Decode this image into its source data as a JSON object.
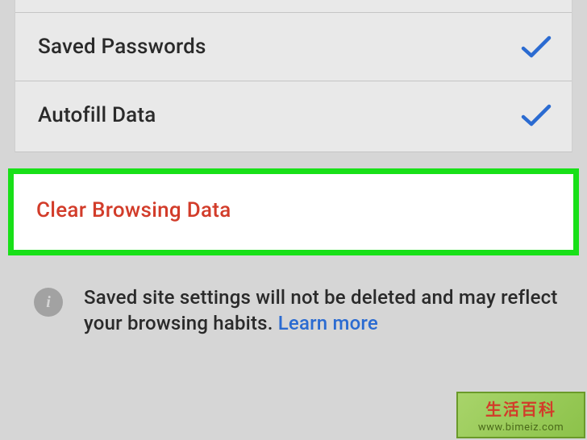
{
  "options": {
    "saved_passwords": {
      "label": "Saved Passwords",
      "checked": true
    },
    "autofill_data": {
      "label": "Autofill Data",
      "checked": true
    }
  },
  "action": {
    "clear_label": "Clear Browsing Data"
  },
  "info": {
    "text_part1": "Saved site settings will not be deleted and may reflect your browsing habits. ",
    "link_text": "Learn more"
  },
  "watermark": {
    "title": "生活百科",
    "url": "www.bimeiz.com"
  },
  "colors": {
    "check_blue": "#2b6bd1",
    "highlight_green": "#18e018",
    "action_red": "#d23c2a",
    "link_blue": "#2b6bd1"
  }
}
